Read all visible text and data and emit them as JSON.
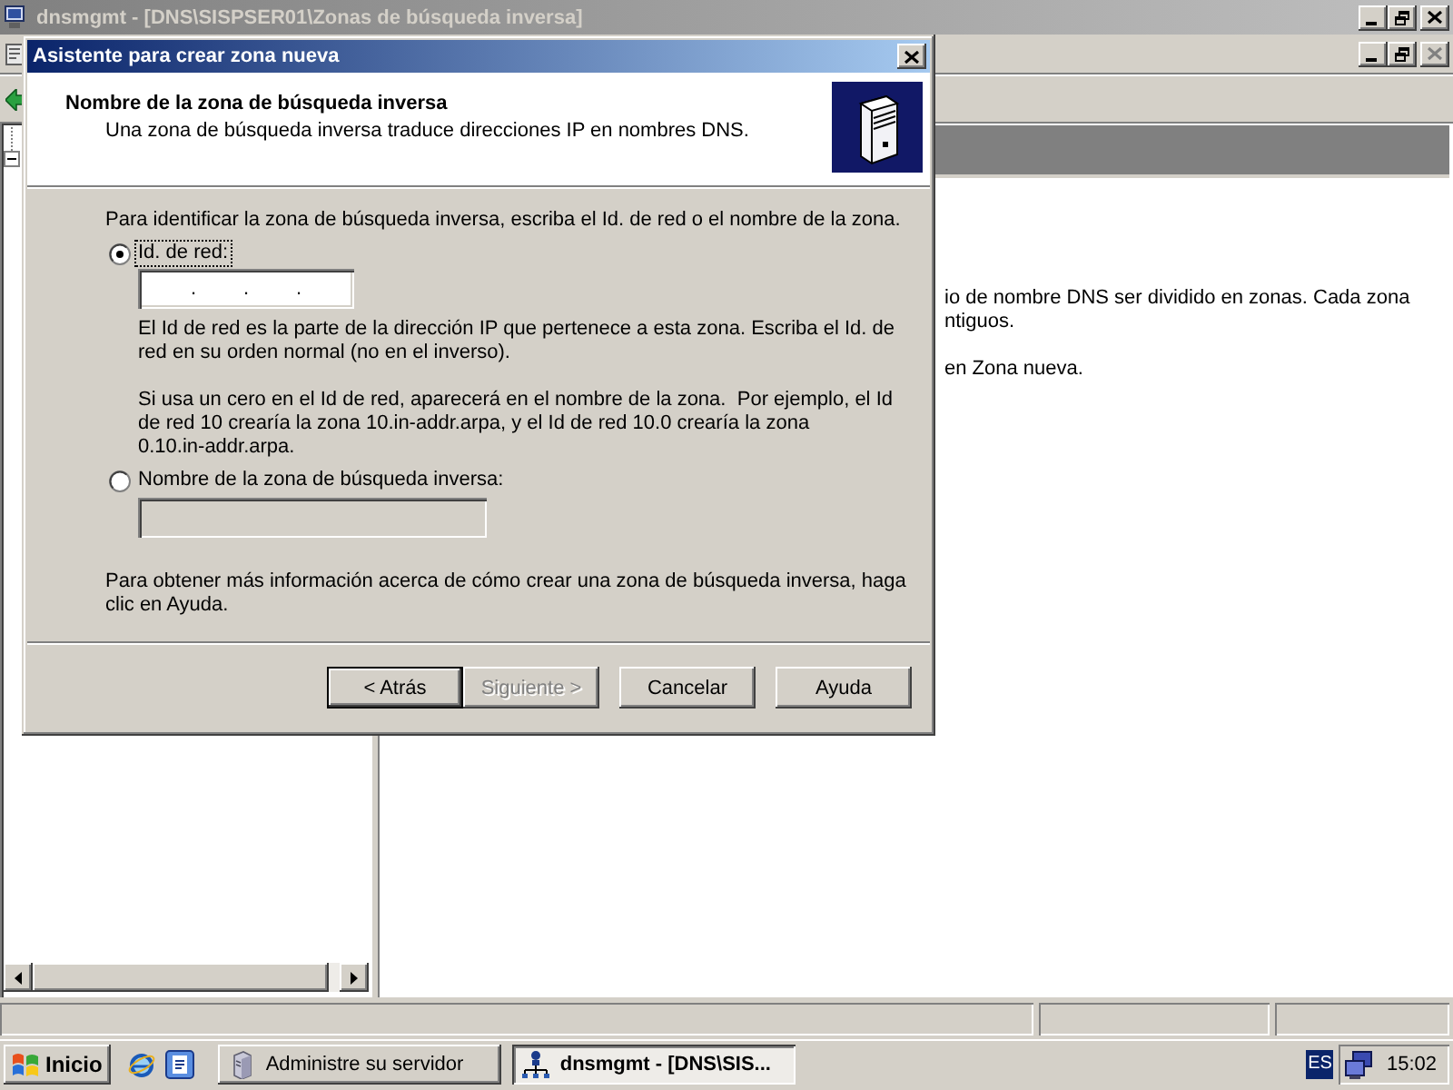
{
  "main_window": {
    "title": "dnsmgmt - [DNS\\SISPSER01\\Zonas de búsqueda inversa]",
    "controls": [
      {
        "kind": "minimize",
        "disabled": false
      },
      {
        "kind": "restore",
        "disabled": false
      },
      {
        "kind": "close",
        "disabled": false
      }
    ]
  },
  "child_window": {
    "controls": [
      {
        "kind": "minimize",
        "disabled": false
      },
      {
        "kind": "restore",
        "disabled": false
      },
      {
        "kind": "close",
        "disabled": true
      }
    ]
  },
  "results_pane": {
    "paragraphs": [
      [
        "io de nombre DNS ser dividido en zonas. Cada zona",
        "ntiguos."
      ],
      [
        "en Zona nueva."
      ]
    ]
  },
  "dialog": {
    "title": "Asistente para crear zona nueva",
    "header_title": "Nombre de la zona de búsqueda inversa",
    "header_subtitle": "Una zona de búsqueda inversa traduce direcciones IP en nombres DNS.",
    "intro": "Para identificar la zona de búsqueda inversa, escriba el Id. de red o el nombre de la zona.",
    "options": [
      {
        "label": "Id. de red:",
        "selected": true,
        "focused": true,
        "field": {
          "kind": "ip",
          "disabled": false,
          "separators": [
            ".",
            ".",
            "."
          ]
        },
        "notes": [
          "El Id de red es la parte de la dirección IP que pertenece a esta zona. Escriba el Id. de red en su orden normal (no en el inverso).",
          "Si usa un cero en el Id de red, aparecerá en el nombre de la zona.  Por ejemplo, el Id de red 10 crearía la zona 10.in-addr.arpa, y el Id de red 10.0 crearía la zona 0.10.in-addr.arpa."
        ]
      },
      {
        "label": "Nombre de la zona de búsqueda inversa:",
        "selected": false,
        "focused": false,
        "field": {
          "kind": "text",
          "disabled": true
        }
      }
    ],
    "help_text": "Para obtener más información acerca de cómo crear una zona de búsqueda inversa, haga clic en Ayuda.",
    "buttons": [
      {
        "label": "< Atrás",
        "kind": "nav",
        "default": true,
        "disabled": false
      },
      {
        "label": "Siguiente >",
        "kind": "nav",
        "default": false,
        "disabled": true
      },
      {
        "label": "Cancelar",
        "kind": "action",
        "default": false,
        "disabled": false
      },
      {
        "label": "Ayuda",
        "kind": "action",
        "default": false,
        "disabled": false
      }
    ]
  },
  "taskbar": {
    "start": "Inicio",
    "tasks": [
      {
        "label": "Administre su servidor",
        "kind": "server",
        "selected": false
      },
      {
        "label": "dnsmgmt - [DNS\\SIS...",
        "kind": "dns",
        "selected": true
      }
    ],
    "language": "ES",
    "clock": "15:02"
  }
}
